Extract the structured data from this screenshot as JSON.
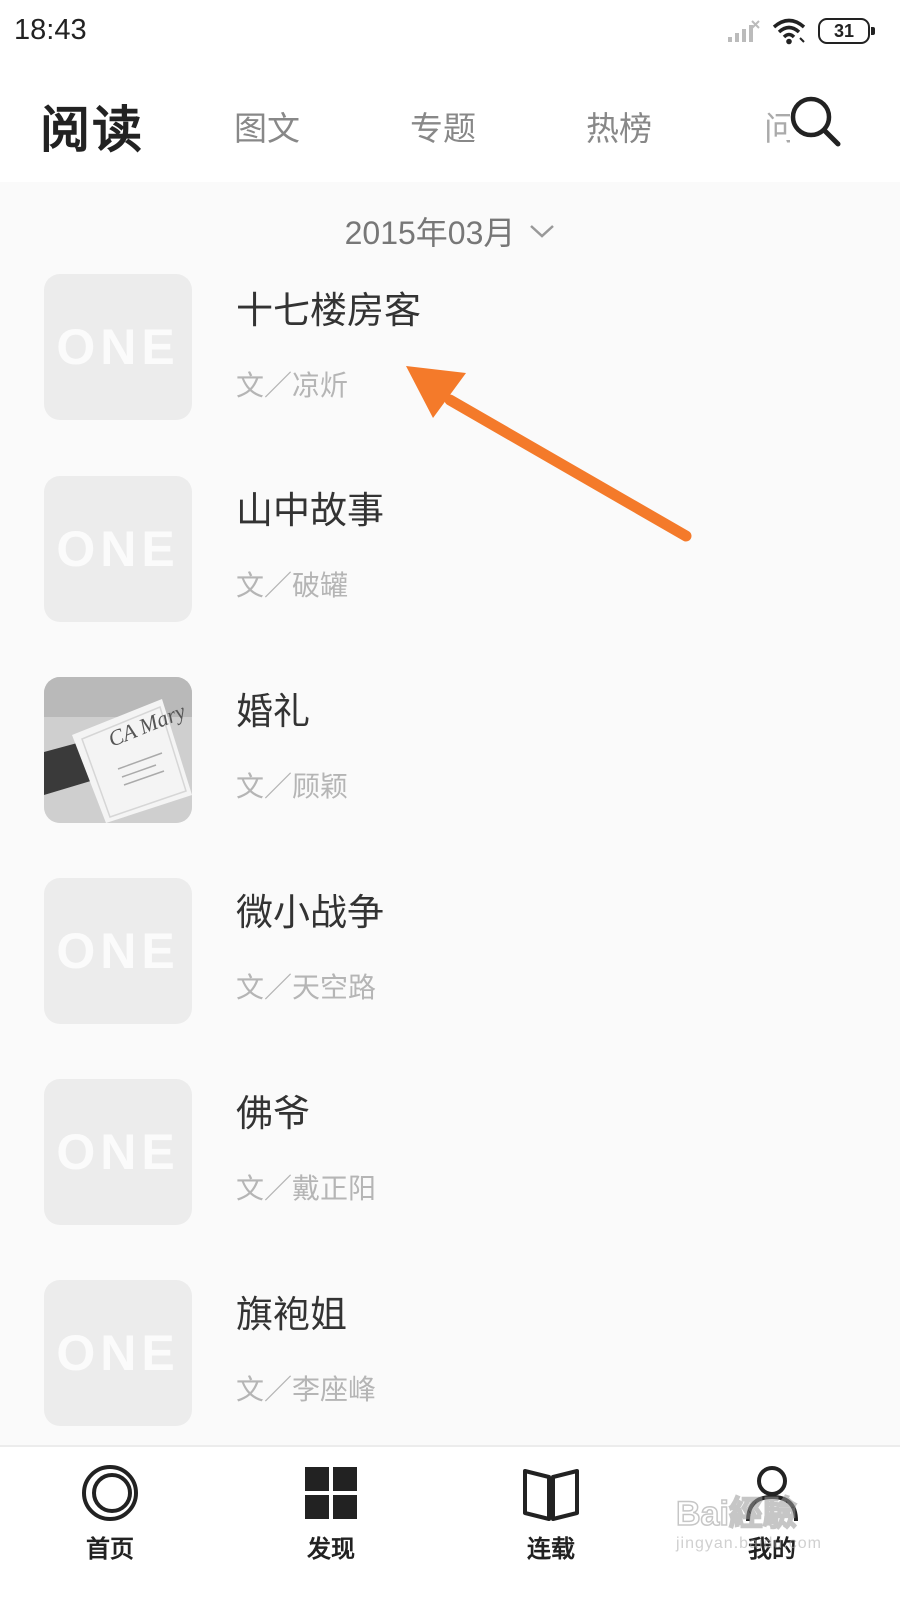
{
  "status_bar": {
    "time": "18:43",
    "battery": "31"
  },
  "header": {
    "title": "阅读",
    "tabs": [
      "图文",
      "专题",
      "热榜",
      "问"
    ]
  },
  "date_selector": {
    "label": "2015年03月"
  },
  "articles": [
    {
      "title": "十七楼房客",
      "author": "文／凉炘",
      "thumbnail": "one-logo"
    },
    {
      "title": "山中故事",
      "author": "文／破罐",
      "thumbnail": "one-logo"
    },
    {
      "title": "婚礼",
      "author": "文／顾颖",
      "thumbnail": "photo",
      "photo_script": "CA Mary"
    },
    {
      "title": "微小战争",
      "author": "文／天空路",
      "thumbnail": "one-logo"
    },
    {
      "title": "佛爷",
      "author": "文／戴正阳",
      "thumbnail": "one-logo"
    },
    {
      "title": "旗袍姐",
      "author": "文／李座峰",
      "thumbnail": "one-logo"
    }
  ],
  "thumbnail_logo_text": "ONE",
  "annotation": {
    "color": "#f47a2a"
  },
  "bottom_nav": [
    {
      "label": "首页",
      "icon": "home-circle-icon"
    },
    {
      "label": "发现",
      "icon": "grid-icon"
    },
    {
      "label": "连载",
      "icon": "book-icon"
    },
    {
      "label": "我的",
      "icon": "person-icon"
    }
  ],
  "watermark": {
    "main": "Bai經驗",
    "sub": "jingyan.baidu.com"
  }
}
